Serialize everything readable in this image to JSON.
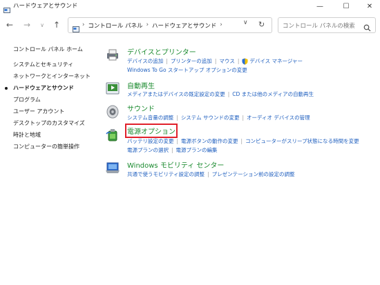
{
  "window": {
    "title": "ハードウェアとサウンド",
    "minimize_glyph": "—",
    "maximize_glyph": "☐",
    "close_glyph": "✕"
  },
  "nav": {
    "back_glyph": "←",
    "forward_glyph": "→",
    "recent_glyph": "∨",
    "up_glyph": "↑"
  },
  "address": {
    "crumbs": [
      "コントロール パネル",
      "ハードウェアとサウンド"
    ],
    "separator": "›",
    "dropdown_glyph": "∨",
    "refresh_glyph": "↻"
  },
  "search": {
    "placeholder": "コントロール パネルの検索"
  },
  "sidebar": {
    "items": [
      {
        "label": "コントロール パネル ホーム"
      },
      {
        "label": "システムとセキュリティ"
      },
      {
        "label": "ネットワークとインターネット"
      },
      {
        "label": "ハードウェアとサウンド"
      },
      {
        "label": "プログラム"
      },
      {
        "label": "ユーザー アカウント"
      },
      {
        "label": "デスクトップのカスタマイズ"
      },
      {
        "label": "時計と地域"
      },
      {
        "label": "コンピューターの簡単操作"
      }
    ],
    "active_index": 3
  },
  "categories": [
    {
      "title": "デバイスとプリンター",
      "icon": "printer-icon",
      "links": [
        [
          "デバイスの追加",
          "プリンターの追加",
          "マウス",
          "デバイス マネージャー"
        ],
        [
          "Windows To Go スタートアップ オプションの変更"
        ]
      ]
    },
    {
      "title": "自動再生",
      "icon": "autoplay-icon",
      "links": [
        [
          "メディアまたはデバイスの既定設定の変更",
          "CD または他のメディアの自動再生"
        ]
      ]
    },
    {
      "title": "サウンド",
      "icon": "speaker-icon",
      "links": [
        [
          "システム音量の調整",
          "システム サウンドの変更",
          "オーディオ デバイスの管理"
        ]
      ]
    },
    {
      "title": "電源オプション",
      "icon": "power-options-icon",
      "highlight_color": "#e0202a",
      "links": [
        [
          "バッテリ設定の変更",
          "電源ボタンの動作の変更",
          "コンピューターがスリープ状態になる時間を変更"
        ],
        [
          "電源プランの選択",
          "電源プランの編集"
        ]
      ]
    },
    {
      "title": "Windows モビリティ センター",
      "icon": "mobility-center-icon",
      "links": [
        [
          "共通で使うモビリティ設定の調整",
          "プレゼンテーション前の設定の調整"
        ]
      ]
    }
  ],
  "link_separator": "|",
  "colors": {
    "category_title": "#1a8a2e",
    "link": "#1f5fbf",
    "highlight": "#e0202a"
  }
}
